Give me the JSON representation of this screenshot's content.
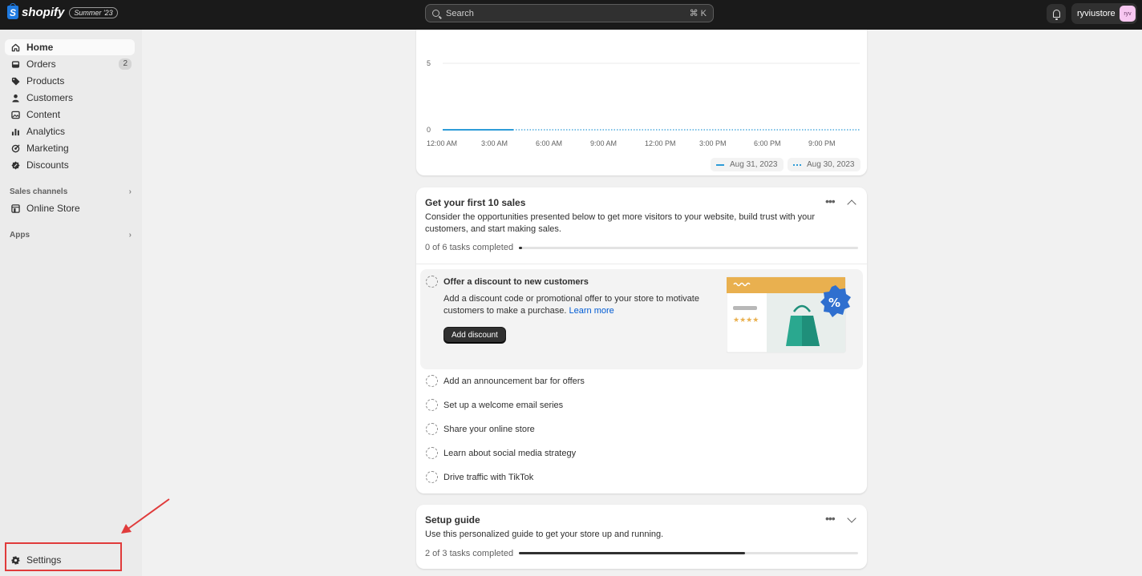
{
  "topbar": {
    "brand": "shopify",
    "version_badge": "Summer '23",
    "search_placeholder": "Search",
    "search_shortcut": "⌘ K",
    "store_name": "ryviustore",
    "avatar_initials": "ryv"
  },
  "sidebar": {
    "items": [
      {
        "label": "Home",
        "icon": "home-icon",
        "active": true
      },
      {
        "label": "Orders",
        "icon": "inbox-icon",
        "badge": "2"
      },
      {
        "label": "Products",
        "icon": "tag-icon"
      },
      {
        "label": "Customers",
        "icon": "person-icon"
      },
      {
        "label": "Content",
        "icon": "image-icon"
      },
      {
        "label": "Analytics",
        "icon": "bar-chart-icon"
      },
      {
        "label": "Marketing",
        "icon": "target-icon"
      },
      {
        "label": "Discounts",
        "icon": "discount-icon"
      }
    ],
    "sales_channels_label": "Sales channels",
    "online_store_label": "Online Store",
    "apps_label": "Apps",
    "settings_label": "Settings"
  },
  "chart_data": {
    "type": "line",
    "x": [
      "12:00 AM",
      "3:00 AM",
      "6:00 AM",
      "9:00 AM",
      "12:00 PM",
      "3:00 PM",
      "6:00 PM",
      "9:00 PM"
    ],
    "y_ticks": [
      "5",
      "0"
    ],
    "ylim": [
      0,
      5
    ],
    "series": [
      {
        "name": "Aug 31, 2023",
        "style": "solid",
        "values": [
          0,
          0
        ]
      },
      {
        "name": "Aug 30, 2023",
        "style": "dotted",
        "values": [
          0,
          0,
          0,
          0,
          0,
          0,
          0,
          0
        ]
      }
    ],
    "color": "#2e9cd8"
  },
  "sales_card": {
    "title": "Get your first 10 sales",
    "description": "Consider the opportunities presented below to get more visitors to your website, build trust with your customers, and start making sales.",
    "progress_label": "0 of 6 tasks completed",
    "progress_fraction": 0.01,
    "active_task": {
      "title": "Offer a discount to new customers",
      "description": "Add a discount code or promotional offer to your store to motivate customers to make a purchase.",
      "link": "Learn more",
      "button": "Add discount"
    },
    "tasks": [
      "Add an announcement bar for offers",
      "Set up a welcome email series",
      "Share your online store",
      "Learn about social media strategy",
      "Drive traffic with TikTok"
    ]
  },
  "setup_card": {
    "title": "Setup guide",
    "description": "Use this personalized guide to get your store up and running.",
    "progress_label": "2 of 3 tasks completed",
    "progress_fraction": 0.667
  }
}
